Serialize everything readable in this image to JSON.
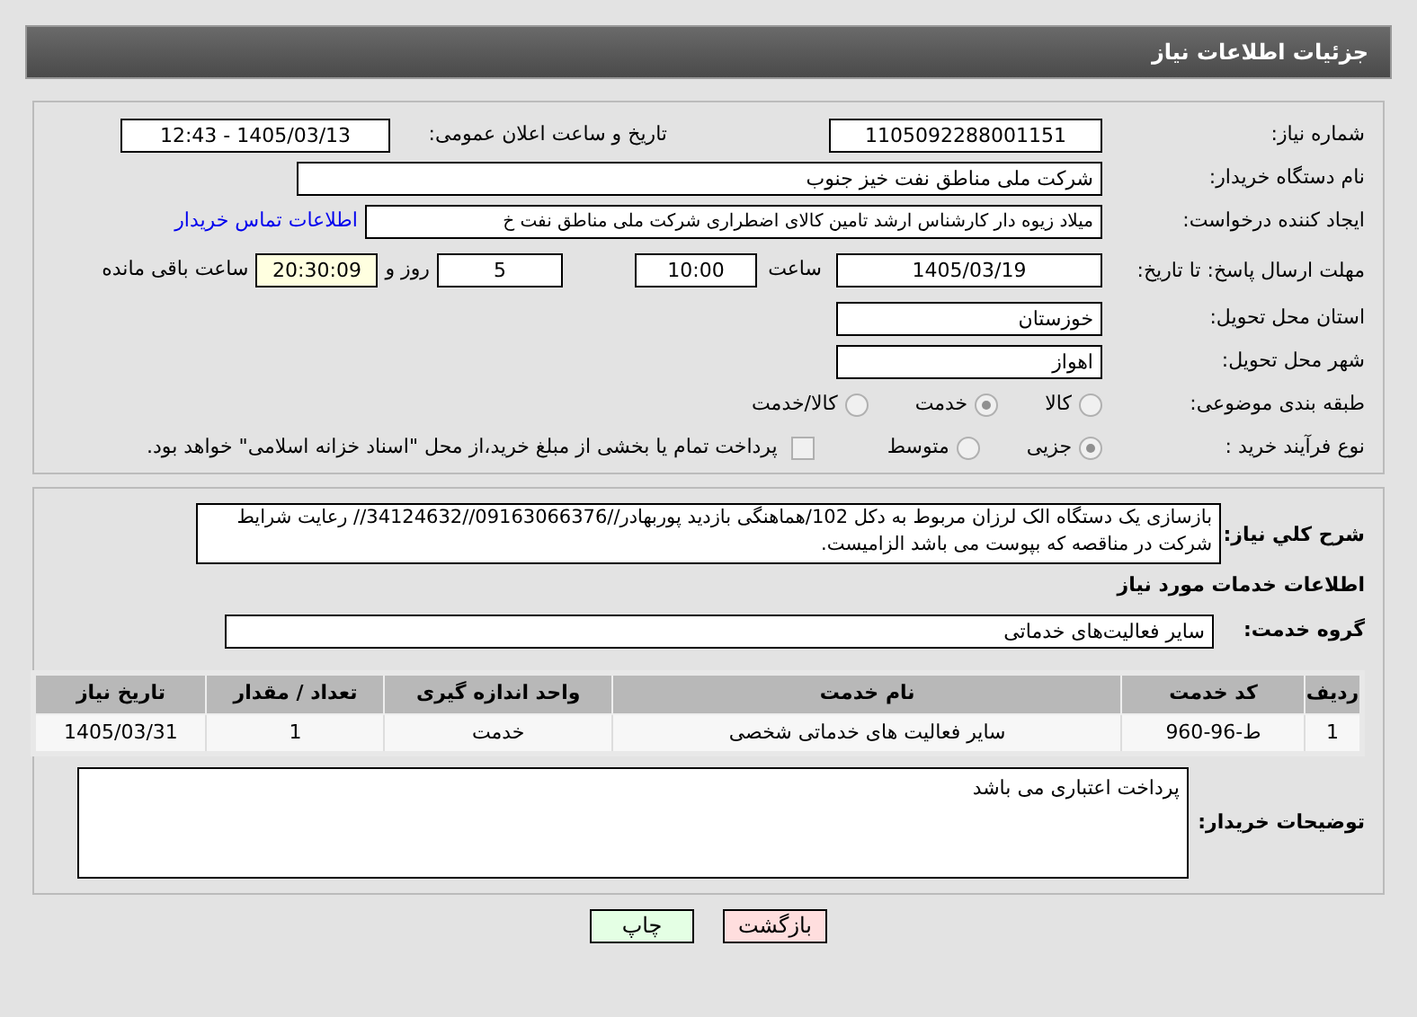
{
  "header": {
    "title": "جزئیات اطلاعات نیاز"
  },
  "need_number": {
    "label": "شماره نیاز:",
    "value": "1105092288001151"
  },
  "announce": {
    "label": "تاریخ و ساعت اعلان عمومی:",
    "value": "1405/03/13 - 12:43"
  },
  "buyer": {
    "label": "نام دستگاه خریدار:",
    "value": "شرکت ملی مناطق نفت خیز جنوب"
  },
  "creator": {
    "label": "ایجاد کننده درخواست:",
    "value": "میلاد زیوه دار  کارشناس ارشد تامین کالای اضطراری شرکت ملی مناطق نفت خ",
    "link": "اطلاعات تماس خریدار"
  },
  "deadline": {
    "label": "مهلت ارسال پاسخ: تا تاریخ:",
    "date": "1405/03/19",
    "time_label": "ساعت",
    "time": "10:00",
    "days": "5",
    "days_label": "روز و",
    "remaining": "20:30:09",
    "remaining_label": "ساعت باقی مانده"
  },
  "province": {
    "label": "استان محل تحویل:",
    "value": "خوزستان"
  },
  "city": {
    "label": "شهر محل تحویل:",
    "value": "اهواز"
  },
  "category": {
    "label": "طبقه بندی موضوعی:",
    "options": [
      {
        "label": "کالا",
        "selected": false
      },
      {
        "label": "خدمت",
        "selected": true
      },
      {
        "label": "کالا/خدمت",
        "selected": false
      }
    ]
  },
  "process": {
    "label": "نوع فرآیند خرید :",
    "options": [
      {
        "label": "جزیی",
        "selected": true
      },
      {
        "label": "متوسط",
        "selected": false
      }
    ],
    "treasury": {
      "label": "پرداخت تمام یا بخشی از مبلغ خرید،از محل \"اسناد خزانه اسلامی\" خواهد بود.",
      "checked": false
    }
  },
  "description": {
    "label": "شرح کلي نياز:",
    "value": "بازسازی یک دستگاه الک لرزان مربوط به دکل 102/هماهنگی بازدید پوربهادر//09163066376//34124632// رعایت شرایط شرکت در مناقصه که بپوست می باشد الزامیست."
  },
  "services_heading": "اطلاعات خدمات مورد نیاز",
  "service_group": {
    "label": "گروه خدمت:",
    "value": "سایر فعالیت‌های خدماتی"
  },
  "table": {
    "columns": [
      "ردیف",
      "کد خدمت",
      "نام خدمت",
      "واحد اندازه گیری",
      "تعداد / مقدار",
      "تاریخ نیاز"
    ],
    "rows": [
      [
        "1",
        "ط-96-960",
        "سایر فعالیت های خدماتی شخصی",
        "خدمت",
        "1",
        "1405/03/31"
      ]
    ]
  },
  "buyer_notes": {
    "label": "توضیحات خریدار:",
    "value": "پرداخت اعتباری می باشد"
  },
  "buttons": [
    {
      "kind": "back",
      "label": "بازگشت"
    },
    {
      "kind": "print",
      "label": "چاپ"
    }
  ]
}
